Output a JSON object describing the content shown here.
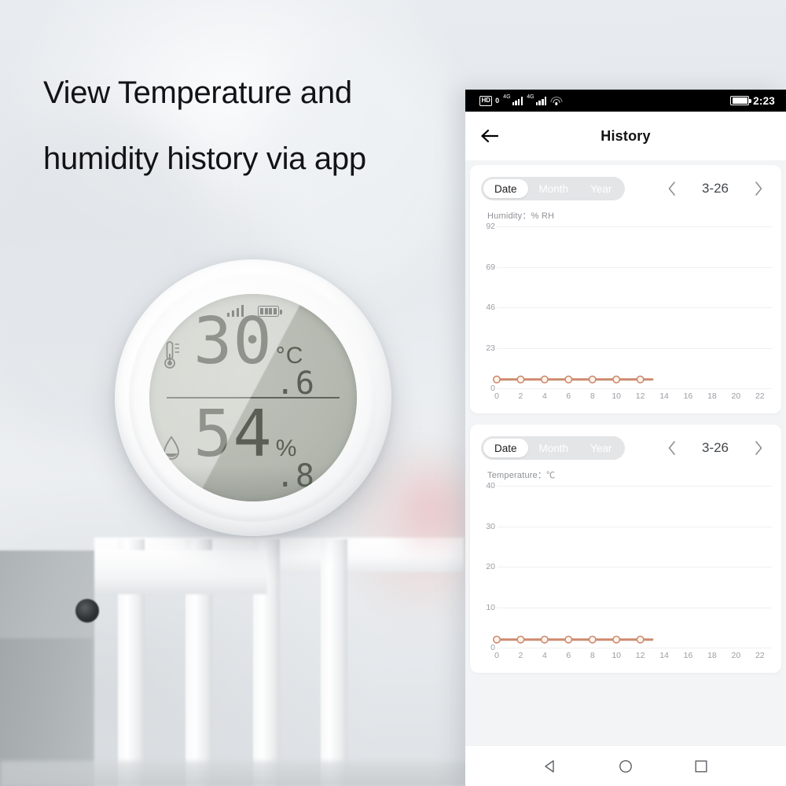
{
  "headline": "View Temperature and\nhumidity history via app",
  "device": {
    "name": "temperature-humidity-sensor",
    "signal_icon": "signal-bars-icon",
    "battery_icon": "battery-icon",
    "temperature": {
      "icon": "thermometer-icon",
      "integer": "30",
      "unit": "°C",
      "decimal": ".6"
    },
    "humidity": {
      "icon": "water-drop-icon",
      "integer": "54",
      "unit": "%",
      "decimal": ".8"
    }
  },
  "phone": {
    "statusbar": {
      "hd_label": "HD",
      "hd_zero": "0",
      "network_label_1": "4G",
      "network_label_2": "4G",
      "wifi_icon": "wifi-icon",
      "battery_icon": "battery-icon",
      "time": "2:23"
    },
    "appbar": {
      "back_icon": "back-arrow-icon",
      "title": "History"
    },
    "navbar": {
      "back_icon": "nav-back-triangle-icon",
      "home_icon": "nav-home-circle-icon",
      "recents_icon": "nav-recents-square-icon"
    },
    "cards": [
      {
        "segments": [
          "Date",
          "Month",
          "Year"
        ],
        "active_segment": "Date",
        "prev_icon": "chevron-left-icon",
        "next_icon": "chevron-right-icon",
        "date": "3-26",
        "axis_title": "Humidity：% RH"
      },
      {
        "segments": [
          "Date",
          "Month",
          "Year"
        ],
        "active_segment": "Date",
        "prev_icon": "chevron-left-icon",
        "next_icon": "chevron-right-icon",
        "date": "3-26",
        "axis_title": "Temperature：℃"
      }
    ]
  },
  "colors": {
    "line": "#cd8a6e",
    "marker_fill": "#fdf5ec",
    "segment_track": "#e4e5e7",
    "page_bg": "#f3f4f6",
    "scene_bg": "#e9edf1"
  },
  "chart_data": [
    {
      "type": "line",
      "title": "Humidity：% RH",
      "xlabel": "",
      "ylabel": "% RH",
      "ylim": [
        0,
        92
      ],
      "xlim": [
        0,
        23
      ],
      "yticks": [
        0,
        23,
        46,
        69,
        92
      ],
      "xticks": [
        0,
        2,
        4,
        6,
        8,
        10,
        12,
        14,
        16,
        18,
        20,
        22
      ],
      "grid": true,
      "legend": "none",
      "x": [
        0,
        2,
        4,
        6,
        8,
        10,
        12
      ],
      "values": [
        5,
        5,
        5,
        5,
        5,
        5,
        5
      ],
      "line_color": "#cd8a6e",
      "marker": "circle"
    },
    {
      "type": "line",
      "title": "Temperature：℃",
      "xlabel": "",
      "ylabel": "℃",
      "ylim": [
        0,
        40
      ],
      "xlim": [
        0,
        23
      ],
      "yticks": [
        0,
        10,
        20,
        30,
        40
      ],
      "xticks": [
        0,
        2,
        4,
        6,
        8,
        10,
        12,
        14,
        16,
        18,
        20,
        22
      ],
      "grid": true,
      "legend": "none",
      "x": [
        0,
        2,
        4,
        6,
        8,
        10,
        12
      ],
      "values": [
        2,
        2,
        2,
        2,
        2,
        2,
        2
      ],
      "line_color": "#cd8a6e",
      "marker": "circle"
    }
  ]
}
